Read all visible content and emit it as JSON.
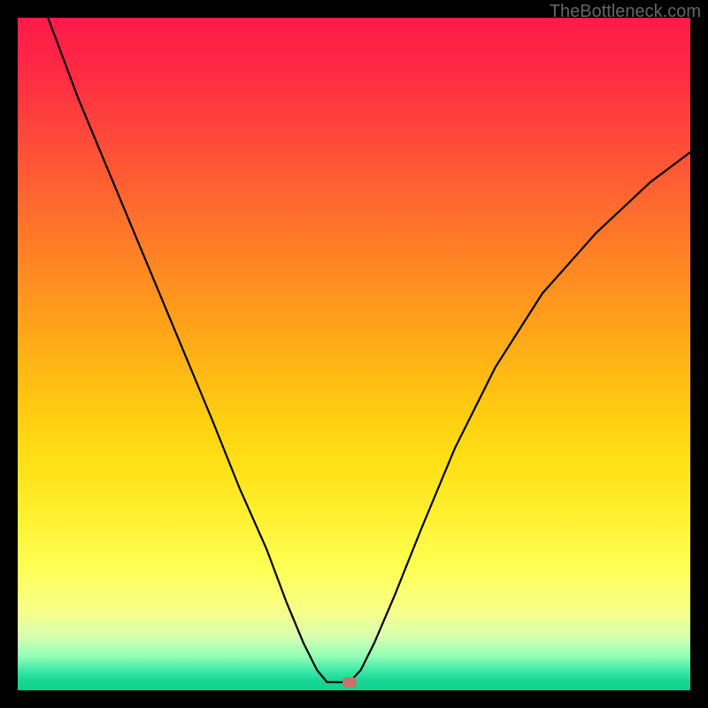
{
  "attribution": "TheBottleneck.com",
  "chart_data": {
    "type": "line",
    "title": "",
    "xlabel": "",
    "ylabel": "",
    "xlim": [
      0,
      100
    ],
    "ylim": [
      0,
      100
    ],
    "curve_points": [
      {
        "x": 4.5,
        "y": 100
      },
      {
        "x": 9,
        "y": 88
      },
      {
        "x": 14,
        "y": 76
      },
      {
        "x": 19,
        "y": 64
      },
      {
        "x": 24,
        "y": 52
      },
      {
        "x": 29,
        "y": 40
      },
      {
        "x": 33,
        "y": 30
      },
      {
        "x": 37,
        "y": 21
      },
      {
        "x": 40,
        "y": 13
      },
      {
        "x": 42.5,
        "y": 7
      },
      {
        "x": 44.5,
        "y": 3
      },
      {
        "x": 46,
        "y": 1.2
      },
      {
        "x": 48,
        "y": 1.2
      },
      {
        "x": 49.3,
        "y": 1.2
      },
      {
        "x": 51,
        "y": 3
      },
      {
        "x": 53,
        "y": 7
      },
      {
        "x": 56,
        "y": 14
      },
      {
        "x": 60,
        "y": 24
      },
      {
        "x": 65,
        "y": 36
      },
      {
        "x": 71,
        "y": 48
      },
      {
        "x": 78,
        "y": 59
      },
      {
        "x": 86,
        "y": 68
      },
      {
        "x": 94,
        "y": 75.5
      },
      {
        "x": 100,
        "y": 80
      }
    ],
    "minimum_point": {
      "x": 49.3,
      "y": 1.2
    },
    "gradient_stops": [
      {
        "pos": 0,
        "color": "#ff1a4a"
      },
      {
        "pos": 50,
        "color": "#ffca10"
      },
      {
        "pos": 85,
        "color": "#ffff55"
      },
      {
        "pos": 100,
        "color": "#10d090"
      }
    ]
  }
}
